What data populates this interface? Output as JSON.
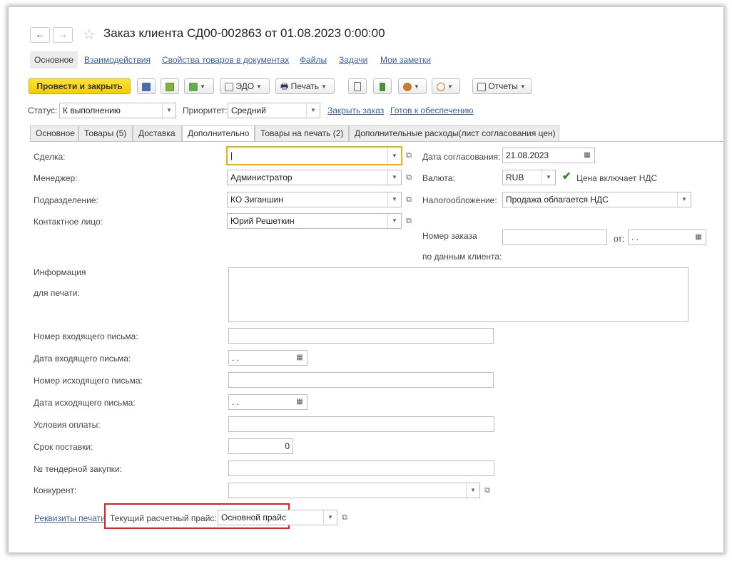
{
  "window": {
    "title": "Заказ клиента СД00-002863 от 01.08.2023 0:00:00",
    "nav_back": "←",
    "nav_forward": "→",
    "star": "☆"
  },
  "nav_tabs": [
    "Основное",
    "Взаимодействия",
    "Свойства товаров в документах",
    "Файлы",
    "Задачи",
    "Мои заметки"
  ],
  "toolbar": {
    "post_close": "Провести и закрыть",
    "edo": "ЭДО",
    "print": "Печать",
    "reports": "Отчеты"
  },
  "status_row": {
    "status_label": "Статус:",
    "status_value": "К выполнению",
    "priority_label": "Приоритет:",
    "priority_value": "Средний",
    "close_order": "Закрыть заказ",
    "ready_supply": "Готов к обеспечению"
  },
  "form_tabs": [
    "Основное",
    "Товары (5)",
    "Доставка",
    "Дополнительно",
    "Товары на печать (2)",
    "Дополнительные расходы(лист согласования цен)"
  ],
  "left_fields": {
    "deal_label": "Сделка:",
    "deal_value": "|",
    "manager_label": "Менеджер:",
    "manager_value": "Администратор",
    "division_label": "Подразделение:",
    "division_value": "КО Зиганшин",
    "contact_label": "Контактное лицо:",
    "contact_value": "Юрий Решеткин",
    "info_label_1": "Информация",
    "info_label_2": "для печати:"
  },
  "right_fields": {
    "approval_date_label": "Дата согласования:",
    "approval_date_value": "21.08.2023",
    "currency_label": "Валюта:",
    "currency_value": "RUB",
    "vat_included_label": "Цена включает НДС",
    "vat_included_checked": true,
    "taxation_label": "Налогообложение:",
    "taxation_value": "Продажа облагается НДС",
    "order_number_label_1": "Номер заказа",
    "order_number_label_2": "по данным клиента:",
    "order_number_value": "",
    "from_label": "от:",
    "from_value": " .  ."
  },
  "lower_fields": {
    "incoming_number_label": "Номер входящего письма:",
    "incoming_date_label": "Дата входящего письма:",
    "incoming_date_value": " .  .",
    "outgoing_number_label": "Номер исходящего письма:",
    "outgoing_date_label": "Дата исходящего письма:",
    "outgoing_date_value": " .  .",
    "payment_terms_label": "Условия оплаты:",
    "delivery_term_label": "Срок поставки:",
    "delivery_term_value": "0",
    "tender_label": "№ тендерной закупки:",
    "competitor_label": "Конкурент:",
    "print_details_link": "Реквизиты печати",
    "price_label": "Текущий расчетный прайс:",
    "price_value": "Основной прайс"
  },
  "colors": {
    "accent_yellow": "#f5d000",
    "link_blue": "#3a5fa0",
    "focus_orange": "#f0b400",
    "highlight_red": "#e02020",
    "check_green": "#2a8a2a"
  }
}
